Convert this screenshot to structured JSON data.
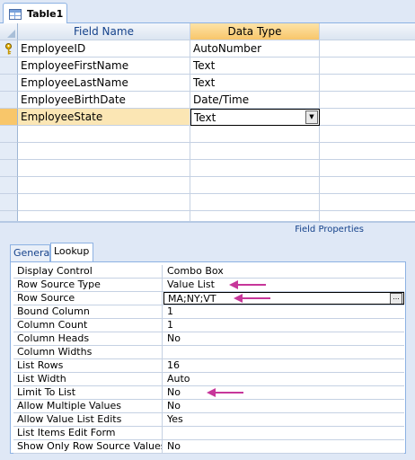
{
  "tab": {
    "label": "Table1",
    "icon": "table-icon"
  },
  "grid": {
    "headers": {
      "field_name": "Field Name",
      "data_type": "Data Type"
    },
    "rows": [
      {
        "field_name": "EmployeeID",
        "data_type": "AutoNumber",
        "primary_key": true
      },
      {
        "field_name": "EmployeeFirstName",
        "data_type": "Text"
      },
      {
        "field_name": "EmployeeLastName",
        "data_type": "Text"
      },
      {
        "field_name": "EmployeeBirthDate",
        "data_type": "Date/Time"
      },
      {
        "field_name": "EmployeeState",
        "data_type": "Text",
        "selected": true
      }
    ]
  },
  "field_properties": {
    "title": "Field Properties",
    "tabs": [
      {
        "label": "General"
      },
      {
        "label": "Lookup",
        "active": true
      }
    ],
    "properties": [
      {
        "label": "Display Control",
        "value": "Combo Box"
      },
      {
        "label": "Row Source Type",
        "value": "Value List"
      },
      {
        "label": "Row Source",
        "value": "MA;NY;VT"
      },
      {
        "label": "Bound Column",
        "value": "1"
      },
      {
        "label": "Column Count",
        "value": "1"
      },
      {
        "label": "Column Heads",
        "value": "No"
      },
      {
        "label": "Column Widths",
        "value": ""
      },
      {
        "label": "List Rows",
        "value": "16"
      },
      {
        "label": "List Width",
        "value": "Auto"
      },
      {
        "label": "Limit To List",
        "value": "No"
      },
      {
        "label": "Allow Multiple Values",
        "value": "No"
      },
      {
        "label": "Allow Value List Edits",
        "value": "Yes"
      },
      {
        "label": "List Items Edit Form",
        "value": ""
      },
      {
        "label": "Show Only Row Source Values",
        "value": "No"
      }
    ]
  },
  "annotation_color": "#c7369a"
}
